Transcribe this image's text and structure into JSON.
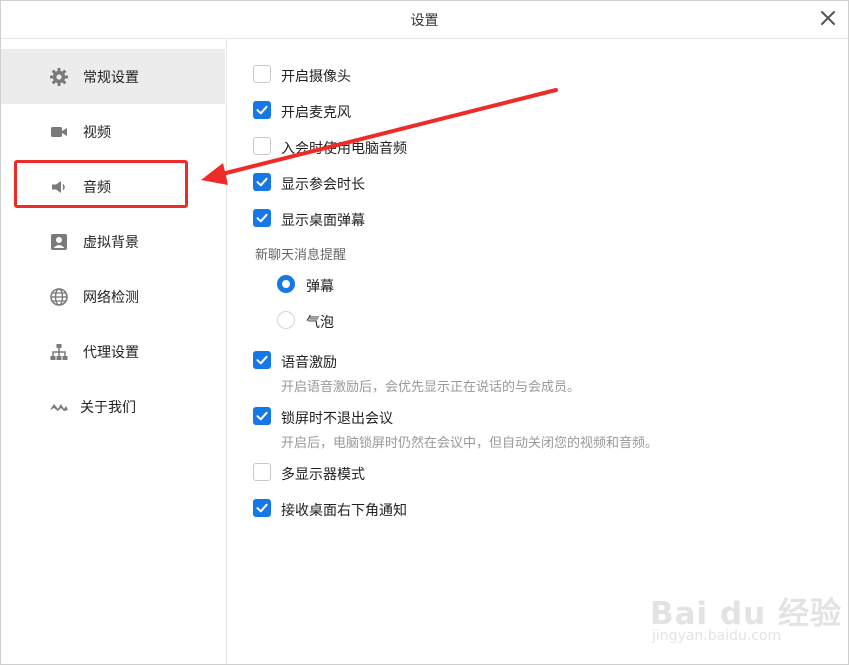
{
  "window": {
    "title": "设置"
  },
  "sidebar": {
    "items": [
      {
        "label": "常规设置",
        "icon": "gear-icon",
        "active": true
      },
      {
        "label": "视频",
        "icon": "video-camera-icon"
      },
      {
        "label": "音频",
        "icon": "speaker-icon",
        "highlighted": true
      },
      {
        "label": "虚拟背景",
        "icon": "virtual-background-icon"
      },
      {
        "label": "网络检测",
        "icon": "globe-icon"
      },
      {
        "label": "代理设置",
        "icon": "network-tree-icon"
      },
      {
        "label": "关于我们",
        "icon": "logo-icon"
      }
    ]
  },
  "settings": {
    "camera": {
      "label": "开启摄像头",
      "checked": false
    },
    "mic": {
      "label": "开启麦克风",
      "checked": true
    },
    "computer_audio": {
      "label": "入会时使用电脑音频",
      "checked": false
    },
    "show_duration": {
      "label": "显示参会时长",
      "checked": true
    },
    "desktop_danmaku": {
      "label": "显示桌面弹幕",
      "checked": true
    },
    "chat_section": {
      "label": "新聊天消息提醒",
      "options": [
        {
          "label": "弹幕",
          "selected": true
        },
        {
          "label": "气泡",
          "selected": false
        }
      ]
    },
    "voice_motivation": {
      "label": "语音激励",
      "checked": true,
      "desc": "开启语音激励后，会优先显示正在说话的与会成员。"
    },
    "lock_screen": {
      "label": "锁屏时不退出会议",
      "checked": true,
      "desc": "开启后，电脑锁屏时仍然在会议中，但自动关闭您的视频和音频。"
    },
    "multi_display": {
      "label": "多显示器模式",
      "checked": false
    },
    "desktop_notify": {
      "label": "接收桌面右下角通知",
      "checked": true
    }
  },
  "annotation": {
    "color": "#ef2b27"
  },
  "accent_color": "#1677e6",
  "watermark": {
    "text": "Bai du 经验",
    "url": "jingyan.baidu.com"
  }
}
